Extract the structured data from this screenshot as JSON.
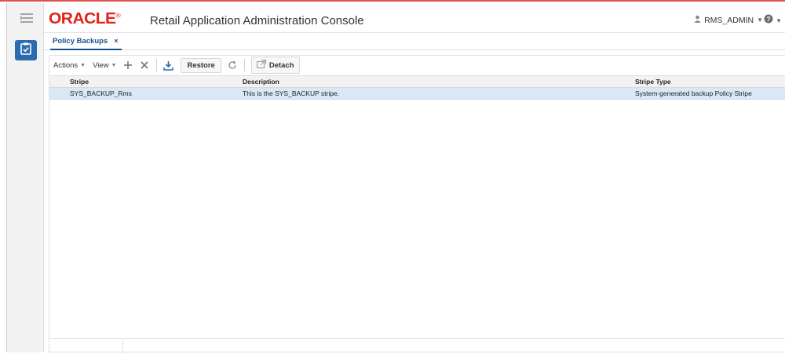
{
  "header": {
    "logo": "ORACLE",
    "logo_mark": "®",
    "app_title": "Retail Application Administration Console",
    "user": "RMS_ADMIN"
  },
  "tabs": [
    {
      "label": "Policy Backups",
      "close": "×"
    }
  ],
  "toolbar": {
    "actions_label": "Actions",
    "view_label": "View",
    "restore_label": "Restore",
    "detach_label": "Detach"
  },
  "table": {
    "columns": [
      "Stripe",
      "Description",
      "Stripe Type"
    ],
    "rows": [
      {
        "stripe": "SYS_BACKUP_Rms",
        "description": "This is the SYS_BACKUP stripe.",
        "stripe_type": "System-generated backup Policy Stripe",
        "selected": true
      }
    ]
  },
  "colors": {
    "brand": "#e2231a",
    "accent": "#1a4f8b",
    "selected_row": "#d8e8f7",
    "task_button": "#2b6cb0"
  },
  "icons": [
    "menu-icon",
    "task-list-icon",
    "user-icon",
    "help-icon",
    "add-icon",
    "delete-icon",
    "download-icon",
    "refresh-icon",
    "detach-icon"
  ]
}
